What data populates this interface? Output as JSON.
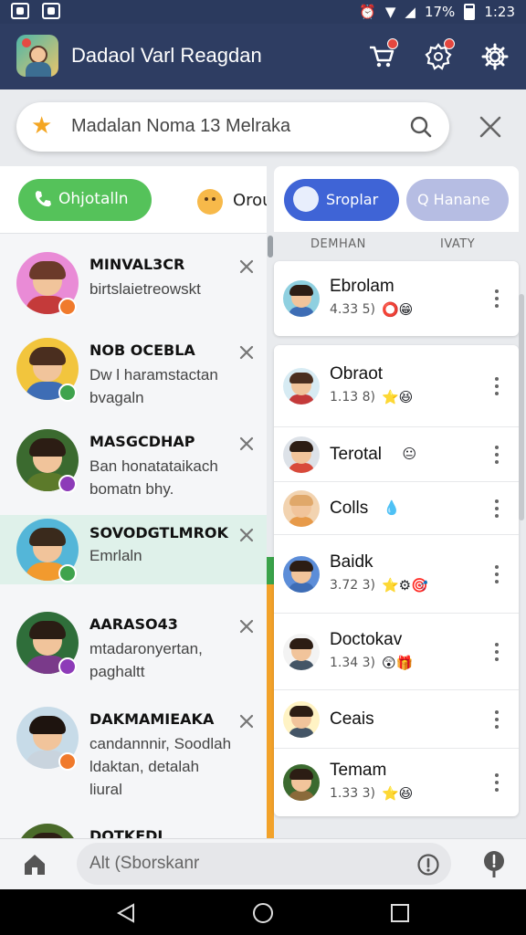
{
  "status_bar": {
    "time": "1:23",
    "battery": "17%"
  },
  "app": {
    "title": "Dadaol Varl Reagdan"
  },
  "search": {
    "placeholder": "Madalan Noma 13 Melraka"
  },
  "left_header": {
    "primary_button": "Ohjotalln",
    "secondary_label": "Orou"
  },
  "chats": [
    {
      "name": "MINVAL3CR",
      "message": "birtslaietreowskt",
      "avatar_hair": "#6b3a2a",
      "avatar_bg": "#e98bd6",
      "avatar_body": "#c43a3a",
      "badge_color": "#f07a2c"
    },
    {
      "name": "NOB OCEBLA",
      "message": "Dw l haramstactan bvagaln",
      "avatar_hair": "#4a2e1f",
      "avatar_bg": "#f2c53d",
      "avatar_body": "#3e6db5",
      "badge_color": "#3fa34d"
    },
    {
      "name": "MASGCDHAP",
      "message": "Ban honatataikach bomatn bhy.",
      "avatar_hair": "#2c1d14",
      "avatar_bg": "#3b6a2f",
      "avatar_body": "#5c7a2a",
      "badge_color": "#8d3bb8"
    },
    {
      "name": "SOVODGTLMROK",
      "message": "Emrlaln",
      "avatar_hair": "#3a2a1c",
      "avatar_bg": "#54b6d8",
      "avatar_body": "#f29a2e",
      "badge_color": "#3fa34d"
    },
    {
      "name": "AARASO43",
      "message": "mtadaronyertan, paghaltt",
      "avatar_hair": "#2a1d14",
      "avatar_bg": "#2f6e3a",
      "avatar_body": "#7a3a8a",
      "badge_color": "#8d3bb8"
    },
    {
      "name": "DAKMAMIEAKA",
      "message": "candannnir, Soodlah ldaktan, detalah liural",
      "avatar_hair": "#1e140f",
      "avatar_bg": "#c7dbe8",
      "avatar_body": "#c9d4de",
      "badge_color": "#f07a2c"
    },
    {
      "name": "DOTKEDI",
      "message": "",
      "avatar_hair": "#2c1d14",
      "avatar_bg": "#4a6a2a",
      "avatar_body": "#5c7a2a",
      "badge_color": "#3fa34d"
    }
  ],
  "right_tabs": {
    "active": "Sroplar",
    "inactive": "Q Hanane"
  },
  "right_columns": {
    "left": "DEMHAN",
    "right": "IVATY"
  },
  "contacts_top": [
    {
      "name": "Ebrolam",
      "sub": "4.33 5)",
      "glyphs": "⭕😁",
      "hair": "#2c1d14",
      "bg": "#8fd0e0",
      "body": "#3e6db5"
    }
  ],
  "contacts": [
    {
      "name": "Obraot",
      "sub": "1.13 8)",
      "glyphs": "⭐😆",
      "hair": "#4a2e1f",
      "bg": "#d7ebf3",
      "body": "#c43a3a"
    },
    {
      "name": "Terotal",
      "sub": "",
      "glyphs": "😐",
      "hair": "#2c1d14",
      "bg": "#dde2e8",
      "body": "#d84a3a"
    },
    {
      "name": "Colls",
      "sub": "",
      "glyphs": "💧",
      "hair": "#e0a86a",
      "bg": "#f2d3b0",
      "body": "#e79a4a"
    },
    {
      "name": "Baidk",
      "sub": "3.72 3)",
      "glyphs": "⭐⚙🎯",
      "hair": "#2c1d14",
      "bg": "#5c8dd8",
      "body": "#3e6db5"
    },
    {
      "name": "Doctokav",
      "sub": "1.34 3)",
      "glyphs": "😲🎁",
      "hair": "#2c1d14",
      "bg": "#f3f3f3",
      "body": "#445566"
    },
    {
      "name": "Ceais",
      "sub": "",
      "glyphs": "",
      "hair": "#2c1d14",
      "bg": "#fff3c4",
      "body": "#445566"
    },
    {
      "name": "Temam",
      "sub": "1.33 3)",
      "glyphs": "⭐😆",
      "hair": "#2c1d14",
      "bg": "#3b6a2f",
      "body": "#8a6a3a"
    }
  ],
  "compose": {
    "placeholder": "Alt (Sborskanr"
  },
  "colors": {
    "appbar": "#2e3d62",
    "accent_green": "#55c25a",
    "accent_blue": "#3f64d6",
    "highlight": "#dff1ea"
  }
}
